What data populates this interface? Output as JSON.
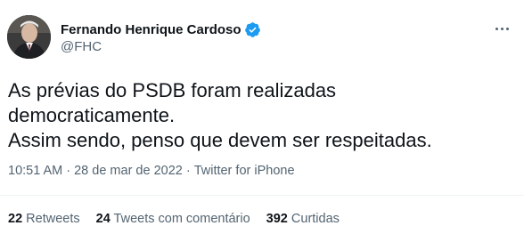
{
  "author": {
    "name": "Fernando Henrique Cardoso",
    "handle": "@FHC",
    "verified_icon": "verified-badge-icon",
    "badge_color": "#1d9bf0"
  },
  "more_icon": "more-options-icon",
  "tweet": {
    "lines": [
      "As prévias do PSDB foram realizadas",
      "democraticamente.",
      "Assim sendo, penso que devem ser respeitadas."
    ]
  },
  "meta": {
    "time": "10:51 AM",
    "separator": "·",
    "date": "28 de mar de 2022",
    "source": "Twitter for iPhone"
  },
  "stats": {
    "retweets_count": "22",
    "retweets_label": "Retweets",
    "quotes_count": "24",
    "quotes_label": "Tweets com comentário",
    "likes_count": "392",
    "likes_label": "Curtidas"
  },
  "colors": {
    "text": "#0f1419",
    "secondary": "#536471",
    "divider": "#eff3f4"
  }
}
